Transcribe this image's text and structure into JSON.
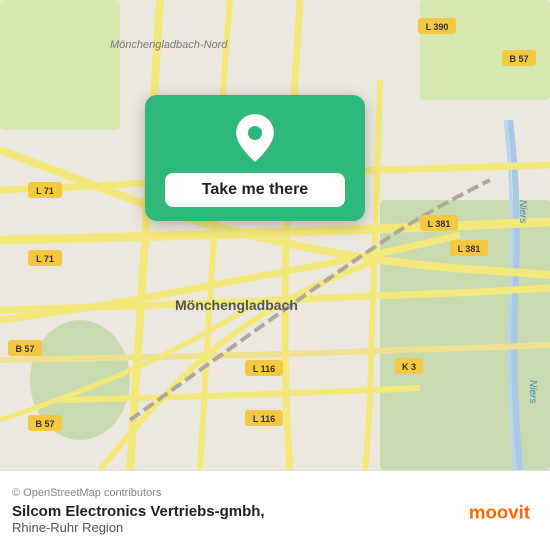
{
  "map": {
    "attribution": "© OpenStreetMap contributors",
    "city_label": "Mönchengladbach",
    "north_label": "Mönchengladbach-Nord",
    "road_labels": [
      "L 71",
      "L 71",
      "B 57",
      "L 381",
      "L 381",
      "L 116",
      "L 116",
      "K 3",
      "B 57",
      "L 390",
      "B 57"
    ]
  },
  "popup": {
    "button_label": "Take me there",
    "icon": "location-pin-icon",
    "bg_color": "#2eb87a"
  },
  "footer": {
    "copyright": "© OpenStreetMap contributors",
    "business_name": "Silcom Electronics Vertriebs-gmbh,",
    "region": "Rhine-Ruhr Region",
    "logo_alt": "moovit"
  }
}
